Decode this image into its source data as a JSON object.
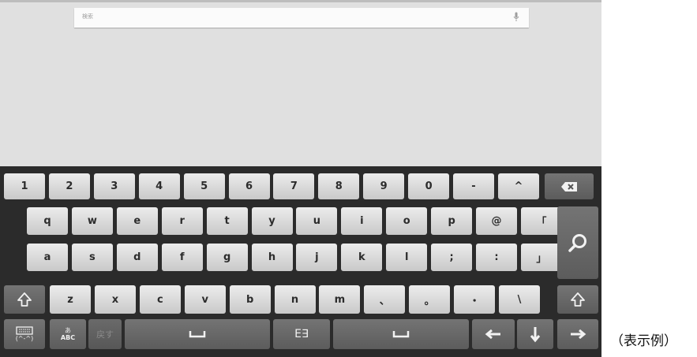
{
  "search": {
    "placeholder": "検索"
  },
  "keyboard": {
    "number_row": [
      "1",
      "2",
      "3",
      "4",
      "5",
      "6",
      "7",
      "8",
      "9",
      "0",
      "-",
      "^"
    ],
    "row_q": [
      "q",
      "w",
      "e",
      "r",
      "t",
      "y",
      "u",
      "i",
      "o",
      "p",
      "@",
      "「"
    ],
    "row_a": [
      "a",
      "s",
      "d",
      "f",
      "g",
      "h",
      "j",
      "k",
      "l",
      ";",
      ":",
      "」"
    ],
    "row_z": [
      "z",
      "x",
      "c",
      "v",
      "b",
      "n",
      "m",
      "、",
      "。",
      "・",
      "\\"
    ],
    "keys": {
      "kana_label": "あ",
      "abc_label": "ABC",
      "emoticon_label": "(^-^)",
      "undo_label": "戻す",
      "mode_label": "E∃"
    },
    "icons": {
      "backspace": "backspace-icon",
      "search": "search-icon",
      "shift": "shift-arrow-icon",
      "settings": "keyboard-settings-icon",
      "space": "space-bar-icon",
      "left": "left-arrow-icon",
      "down": "down-arrow-icon",
      "right": "right-arrow-icon",
      "mic": "microphone-icon"
    }
  },
  "caption": "（表示例）"
}
